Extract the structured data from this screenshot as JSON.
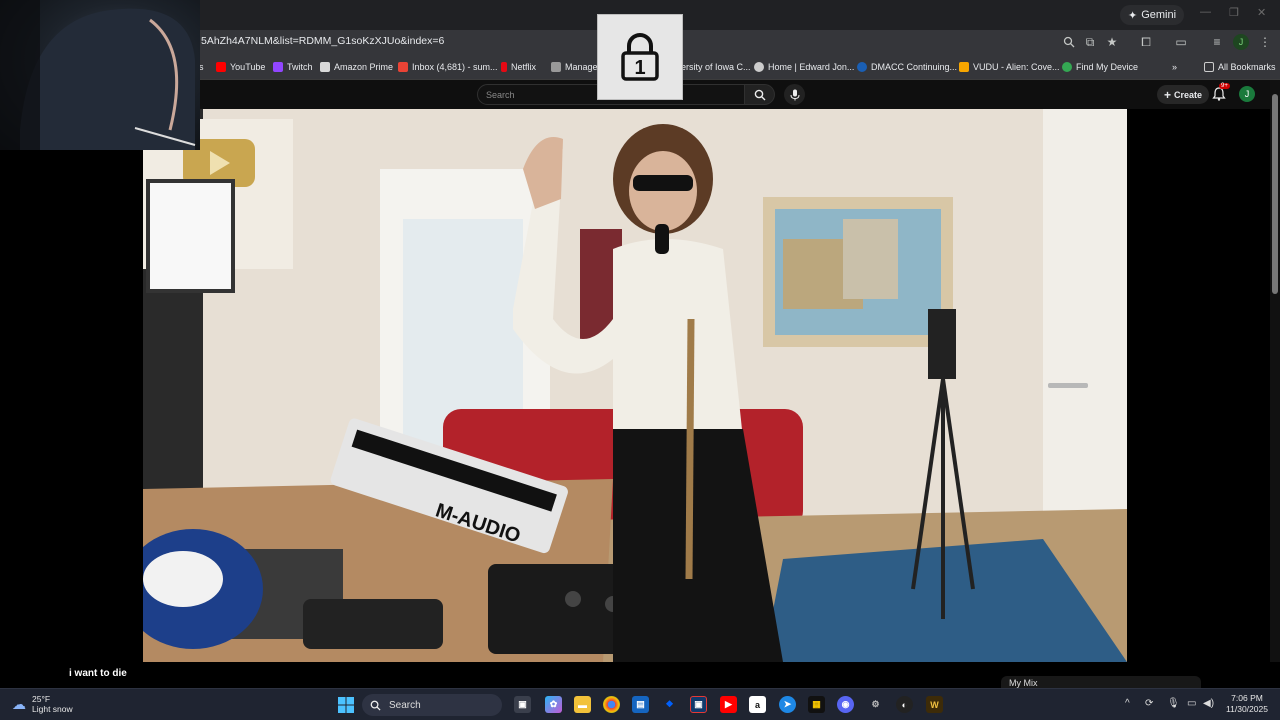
{
  "browser": {
    "gemini_label": "Gemini",
    "url": "5AhZh4A7NLM&list=RDMM_G1soKzXJUo&index=6",
    "profile_initial": "J",
    "bookmarks": [
      {
        "label": "s",
        "color": "#555555"
      },
      {
        "label": "YouTube",
        "color": "#ff0000"
      },
      {
        "label": "Twitch",
        "color": "#9146ff"
      },
      {
        "label": "Amazon Prime",
        "color": "#d9d9d9"
      },
      {
        "label": "Inbox (4,681) - sum...",
        "color": "#ea4335"
      },
      {
        "label": "Netflix",
        "color": "#e50914"
      },
      {
        "label": "Manage y",
        "color": "#999999"
      },
      {
        "label": "ersity of Iowa C...",
        "color": "#ffcd00"
      },
      {
        "label": "Home | Edward Jon...",
        "color": "#cccccc"
      },
      {
        "label": "DMACC Continuing...",
        "color": "#1a5fb4"
      },
      {
        "label": "VUDU - Alien: Cove...",
        "color": "#f7a600"
      },
      {
        "label": "Find My Device",
        "color": "#34a853"
      }
    ],
    "all_bookmarks_label": "All Bookmarks"
  },
  "youtube": {
    "search_placeholder": "Search",
    "create_label": "Create",
    "notification_badge": "9+",
    "avatar_initial": "J",
    "caption": "i want to die",
    "mymix_label": "My Mix"
  },
  "lock_overlay": {
    "number": "1"
  },
  "taskbar": {
    "weather_temp": "25°F",
    "weather_desc": "Light snow",
    "search_label": "Search",
    "time": "7:06 PM",
    "date": "11/30/2025"
  }
}
